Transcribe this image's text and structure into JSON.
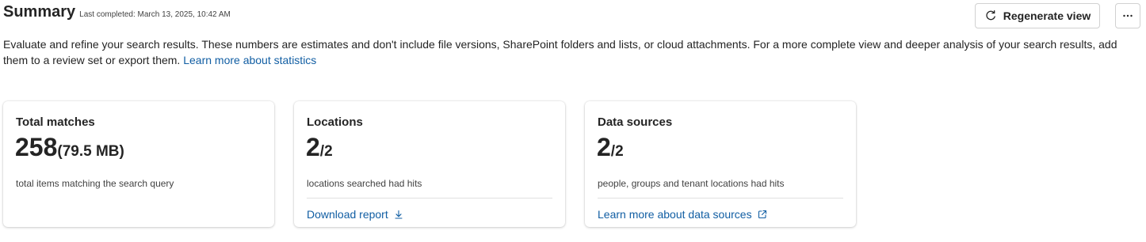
{
  "header": {
    "title": "Summary",
    "last_completed": "Last completed: March 13, 2025, 10:42 AM",
    "regenerate_label": "Regenerate view",
    "refresh_icon": "refresh-icon",
    "more_icon": "more-horizontal-icon"
  },
  "description": {
    "text": "Evaluate and refine your search results. These numbers are estimates and don't include file versions, SharePoint folders and lists, or cloud attachments. For a more complete view and deeper analysis of your search results, add them to a review set or export them.",
    "link": "Learn more about statistics"
  },
  "cards": [
    {
      "title": "Total matches",
      "value": "258",
      "suffix": "(79.5 MB)",
      "description": "total items matching the search query"
    },
    {
      "title": "Locations",
      "value": "2",
      "suffix": "/2",
      "description": "locations searched had hits",
      "link": "Download report",
      "link_icon": "download-icon"
    },
    {
      "title": "Data sources",
      "value": "2",
      "suffix": "/2",
      "description": "people, groups and tenant locations had hits",
      "link": "Learn more about data sources",
      "link_icon": "open-external-icon"
    }
  ],
  "colors": {
    "link": "#115ea3",
    "text": "#242424",
    "border": "#d1d1d1"
  }
}
